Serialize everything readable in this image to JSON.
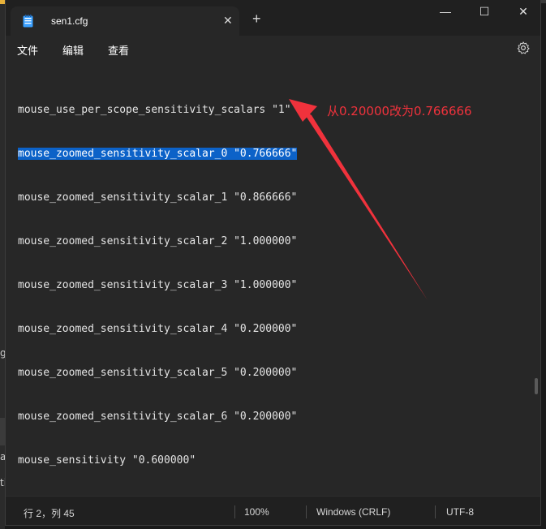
{
  "window": {
    "tab_title": "sen1.cfg",
    "tab_close_glyph": "✕",
    "new_tab_glyph": "+",
    "controls": {
      "minimize": "—",
      "maximize": "☐",
      "close": "✕"
    }
  },
  "menu": {
    "file": "文件",
    "edit": "编辑",
    "view": "查看"
  },
  "editor": {
    "lines": [
      "mouse_use_per_scope_sensitivity_scalars \"1\"",
      "mouse_zoomed_sensitivity_scalar_0 \"0.766666\"",
      "mouse_zoomed_sensitivity_scalar_1 \"0.866666\"",
      "mouse_zoomed_sensitivity_scalar_2 \"1.000000\"",
      "mouse_zoomed_sensitivity_scalar_3 \"1.000000\"",
      "mouse_zoomed_sensitivity_scalar_4 \"0.200000\"",
      "mouse_zoomed_sensitivity_scalar_5 \"0.200000\"",
      "mouse_zoomed_sensitivity_scalar_6 \"0.200000\"",
      "mouse_sensitivity \"0.600000\""
    ],
    "selected_line_index": 1
  },
  "annotation": {
    "text": "从0.20000改为0.766666",
    "color": "#f0323c"
  },
  "status": {
    "position": "行 2，列 45",
    "zoom": "100%",
    "line_ending": "Windows (CRLF)",
    "encoding": "UTF-8"
  },
  "background": {
    "glyph_1": "g",
    "glyph_2": "a",
    "glyph_3": "ti"
  },
  "colors": {
    "selection": "#0c62c8",
    "editor_bg": "#272727",
    "titlebar_bg": "#202020"
  }
}
